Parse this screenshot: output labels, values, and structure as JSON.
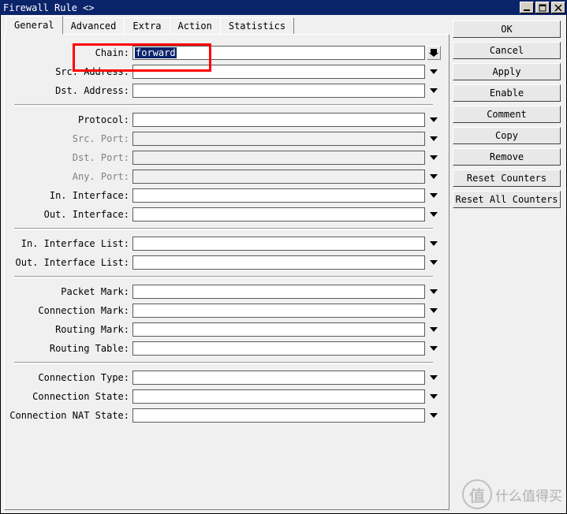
{
  "window": {
    "title": "Firewall Rule <>"
  },
  "tabs": {
    "t0": "General",
    "t1": "Advanced",
    "t2": "Extra",
    "t3": "Action",
    "t4": "Statistics"
  },
  "fields": {
    "chain": {
      "label": "Chain:",
      "value": "forward",
      "arrow": "combo",
      "enabled": true
    },
    "src_address": {
      "label": "Src. Address:",
      "value": "",
      "arrow": "expand",
      "enabled": true
    },
    "dst_address": {
      "label": "Dst. Address:",
      "value": "",
      "arrow": "expand",
      "enabled": true
    },
    "protocol": {
      "label": "Protocol:",
      "value": "",
      "arrow": "expand",
      "enabled": true
    },
    "src_port": {
      "label": "Src. Port:",
      "value": "",
      "arrow": "expand",
      "enabled": false
    },
    "dst_port": {
      "label": "Dst. Port:",
      "value": "",
      "arrow": "expand",
      "enabled": false
    },
    "any_port": {
      "label": "Any. Port:",
      "value": "",
      "arrow": "expand",
      "enabled": false
    },
    "in_interface": {
      "label": "In. Interface:",
      "value": "",
      "arrow": "expand",
      "enabled": true
    },
    "out_interface": {
      "label": "Out. Interface:",
      "value": "",
      "arrow": "expand",
      "enabled": true
    },
    "in_interface_list": {
      "label": "In. Interface List:",
      "value": "",
      "arrow": "expand",
      "enabled": true
    },
    "out_interface_list": {
      "label": "Out. Interface List:",
      "value": "",
      "arrow": "expand",
      "enabled": true
    },
    "packet_mark": {
      "label": "Packet Mark:",
      "value": "",
      "arrow": "expand",
      "enabled": true
    },
    "connection_mark": {
      "label": "Connection Mark:",
      "value": "",
      "arrow": "expand",
      "enabled": true
    },
    "routing_mark": {
      "label": "Routing Mark:",
      "value": "",
      "arrow": "expand",
      "enabled": true
    },
    "routing_table": {
      "label": "Routing Table:",
      "value": "",
      "arrow": "expand",
      "enabled": true
    },
    "connection_type": {
      "label": "Connection Type:",
      "value": "",
      "arrow": "expand",
      "enabled": true
    },
    "connection_state": {
      "label": "Connection State:",
      "value": "",
      "arrow": "expand",
      "enabled": true
    },
    "connection_nat_state": {
      "label": "Connection NAT State:",
      "value": "",
      "arrow": "expand",
      "enabled": true
    }
  },
  "buttons": {
    "ok": "OK",
    "cancel": "Cancel",
    "apply": "Apply",
    "enable": "Enable",
    "comment": "Comment",
    "copy": "Copy",
    "remove": "Remove",
    "reset_counters": "Reset Counters",
    "reset_all_counters": "Reset All Counters"
  },
  "watermark": {
    "icon_text": "值",
    "text": "什么值得买"
  }
}
